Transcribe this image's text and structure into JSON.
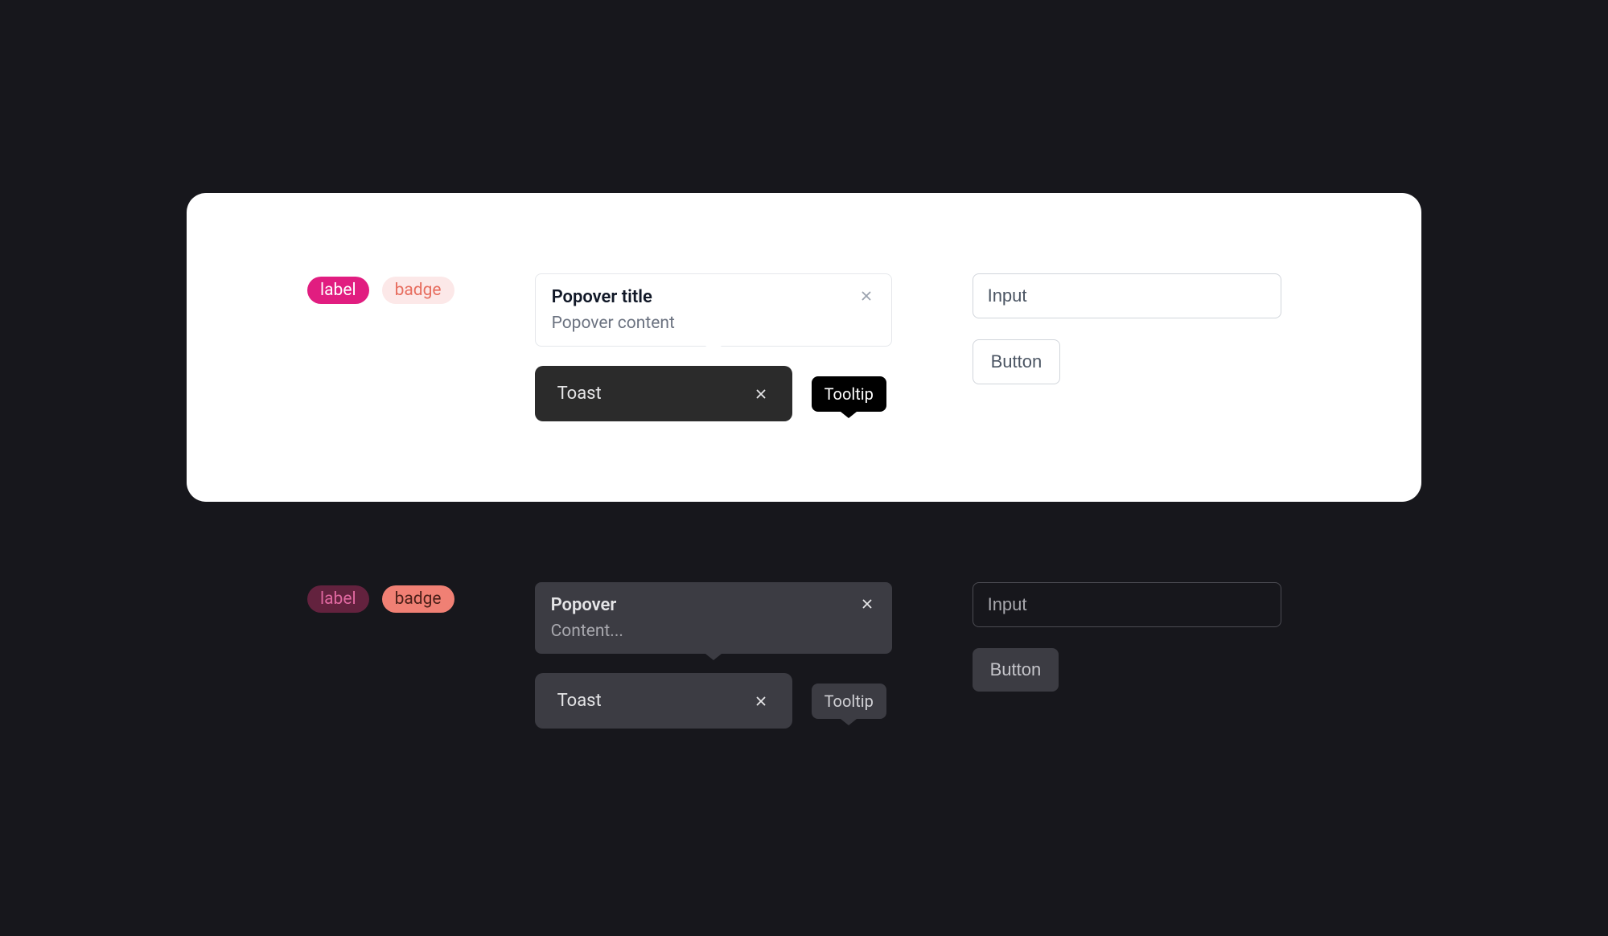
{
  "light": {
    "label_pill": "label",
    "badge_pill": "badge",
    "popover": {
      "title": "Popover title",
      "content": "Popover content"
    },
    "toast": "Toast",
    "tooltip": "Tooltip",
    "input_value": "Input",
    "button": "Button"
  },
  "dark": {
    "label_pill": "label",
    "badge_pill": "badge",
    "popover": {
      "title": "Popover",
      "content": "Content..."
    },
    "toast": "Toast",
    "tooltip": "Tooltip",
    "input_value": "Input",
    "button": "Button"
  }
}
